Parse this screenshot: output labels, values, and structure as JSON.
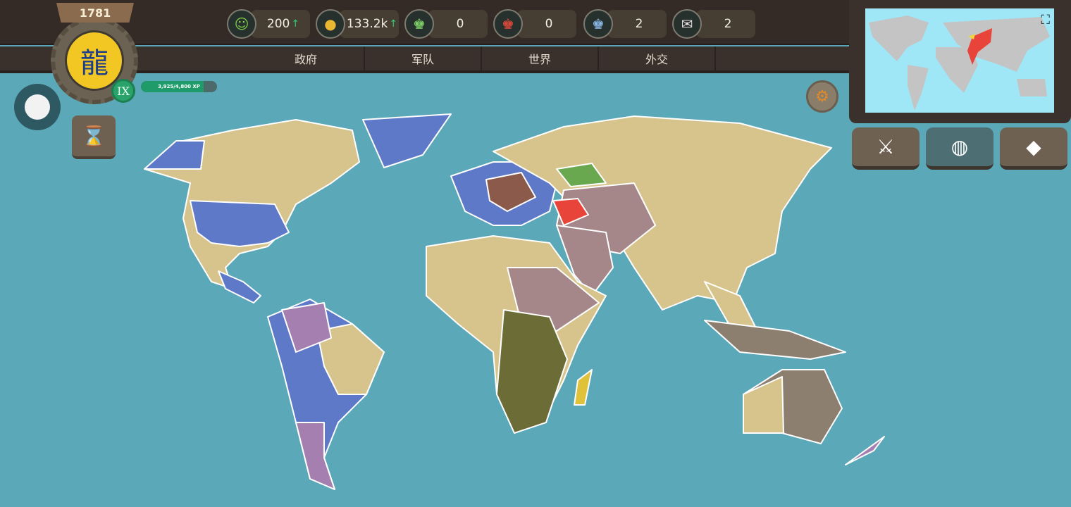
{
  "header": {
    "year": "1781",
    "level": "IX",
    "xp_text": "3,925/4,800 XP",
    "xp_progress": 0.82
  },
  "resources": [
    {
      "name": "happiness",
      "icon": "smiley-icon",
      "glyph": "☺",
      "color": "#7fc84a",
      "value": "200",
      "trend": "↑"
    },
    {
      "name": "gold",
      "icon": "coins-icon",
      "glyph": "●",
      "color": "#e8b630",
      "value": "133.2k",
      "trend": "↑"
    },
    {
      "name": "green-king",
      "icon": "green-crown-icon",
      "glyph": "♚",
      "color": "#7fd46a",
      "value": "0",
      "trend": ""
    },
    {
      "name": "red-king",
      "icon": "red-crown-icon",
      "glyph": "♚",
      "color": "#e04a3a",
      "value": "0",
      "trend": ""
    },
    {
      "name": "blue-king",
      "icon": "blue-crown-icon",
      "glyph": "♚",
      "color": "#8ab8e8",
      "value": "2",
      "trend": ""
    },
    {
      "name": "treaty",
      "icon": "scroll-seal-icon",
      "glyph": "✉",
      "color": "#e8e0e0",
      "value": "2",
      "trend": ""
    }
  ],
  "tabs": [
    "政府",
    "军队",
    "世界",
    "外交"
  ],
  "side_buttons": [
    {
      "name": "war",
      "glyph": "⚔"
    },
    {
      "name": "world",
      "glyph": "◍"
    },
    {
      "name": "gems",
      "glyph": "◆"
    }
  ],
  "colors": {
    "ocean": "#5ba8b8",
    "tan": "#d7c48c",
    "blue": "#5f79c9",
    "purple": "#a57fb0",
    "olive": "#6b6c36",
    "mauve": "#a5878a",
    "taupe": "#8c7f70",
    "player": "#e8443a"
  }
}
